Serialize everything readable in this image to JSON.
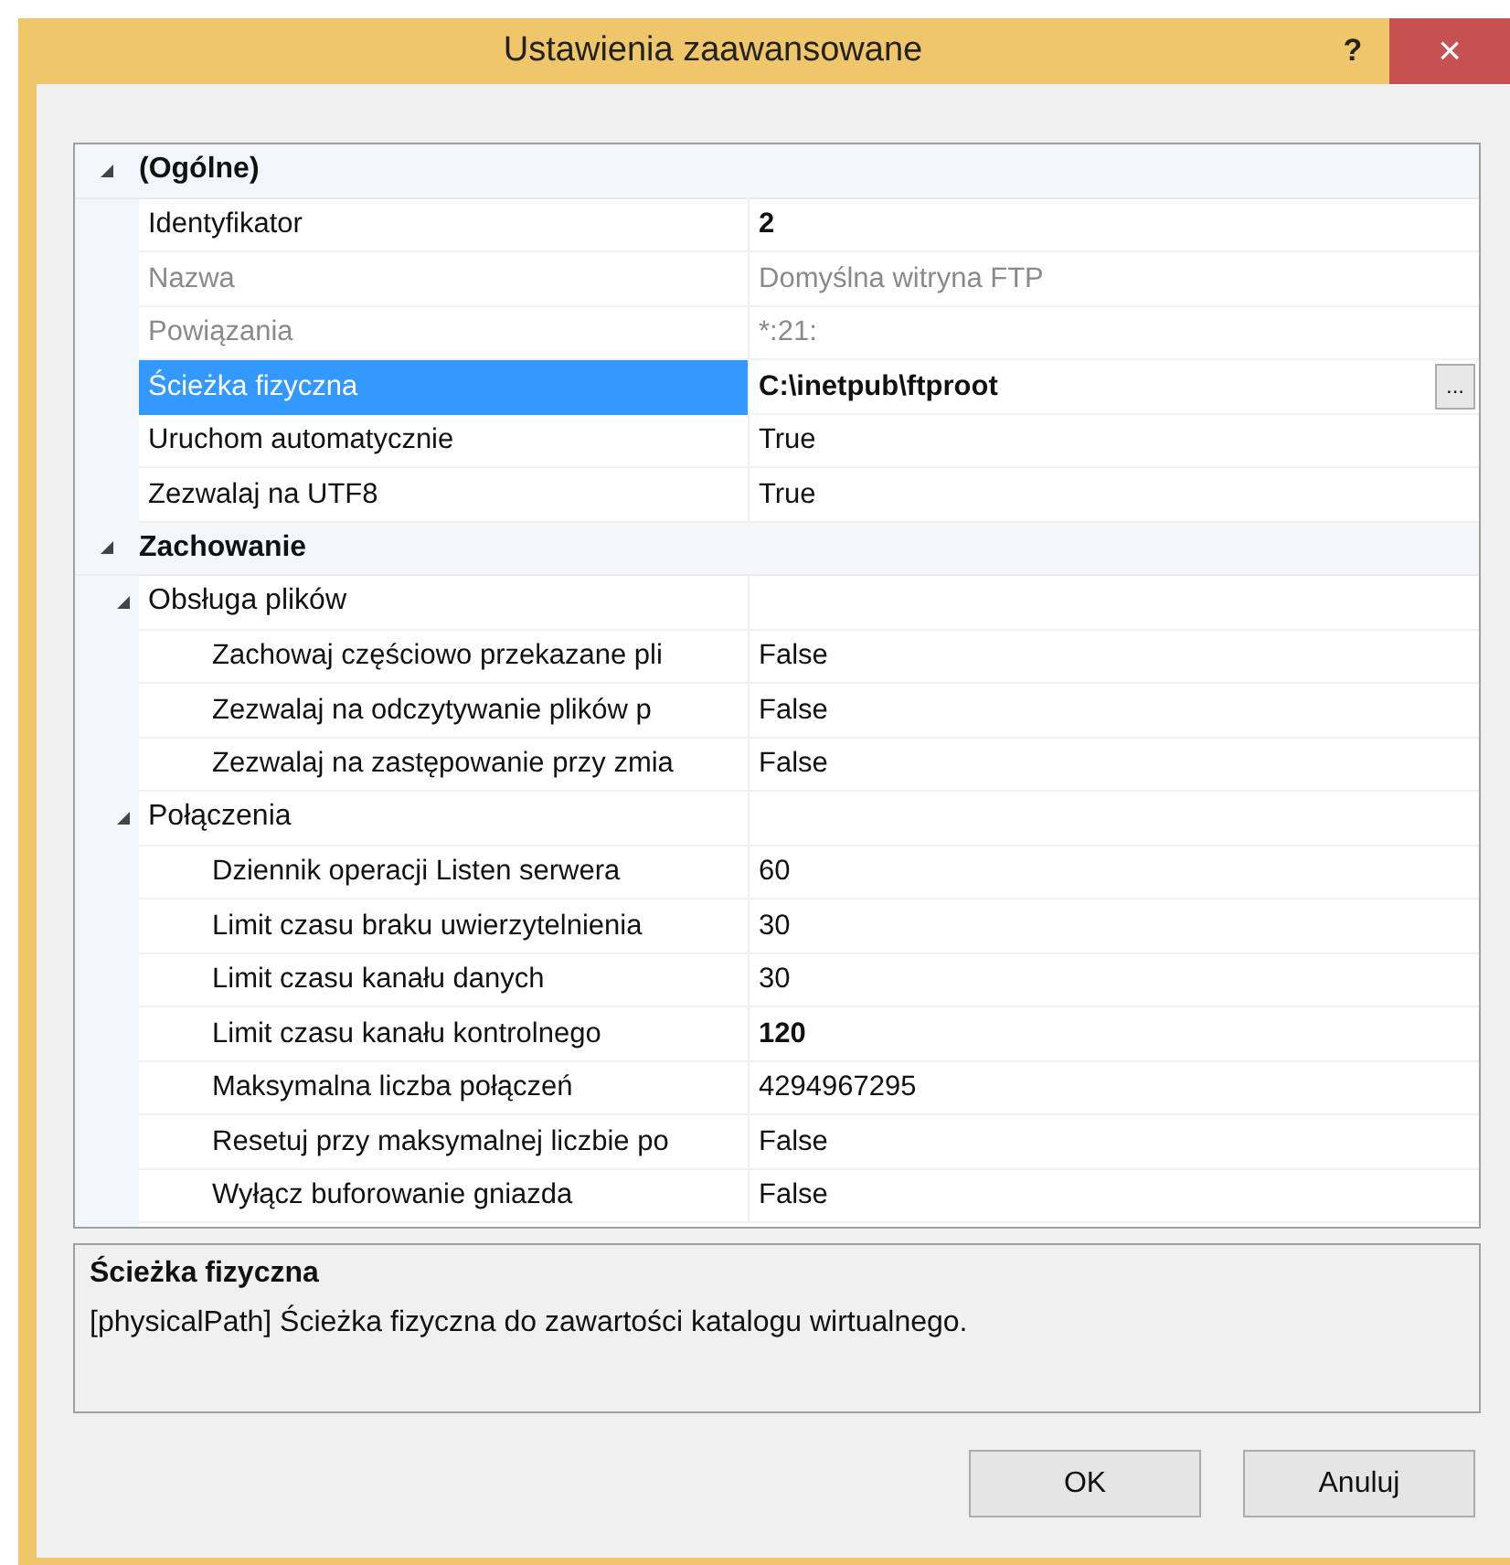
{
  "window": {
    "title": "Ustawienia zaawansowane",
    "help": "?",
    "close": "×"
  },
  "grid": [
    {
      "kind": "category",
      "label": "(Ogólne)",
      "expanded": true,
      "children": [
        {
          "kind": "property",
          "name": "Identyfikator",
          "value": "2",
          "modified": true,
          "disabled": false,
          "selected": false
        },
        {
          "kind": "property",
          "name": "Nazwa",
          "value": "Domyślna witryna FTP",
          "modified": false,
          "disabled": true,
          "selected": false
        },
        {
          "kind": "property",
          "name": "Powiązania",
          "value": "*:21:",
          "modified": false,
          "disabled": true,
          "selected": false
        },
        {
          "kind": "property",
          "name": "Ścieżka fizyczna",
          "value": "C:\\inetpub\\ftproot",
          "modified": true,
          "disabled": false,
          "selected": true,
          "button": "..."
        },
        {
          "kind": "property",
          "name": "Uruchom automatycznie",
          "value": "True",
          "modified": false,
          "disabled": false,
          "selected": false
        },
        {
          "kind": "property",
          "name": "Zezwalaj na UTF8",
          "value": "True",
          "modified": false,
          "disabled": false,
          "selected": false
        }
      ]
    },
    {
      "kind": "category",
      "label": "Zachowanie",
      "expanded": true,
      "children": [
        {
          "kind": "group",
          "label": "Obsługa plików",
          "expanded": true,
          "children": [
            {
              "kind": "property",
              "name": "Zachowaj częściowo przekazane pli",
              "value": "False",
              "modified": false,
              "disabled": false,
              "selected": false
            },
            {
              "kind": "property",
              "name": "Zezwalaj na odczytywanie plików p",
              "value": "False",
              "modified": false,
              "disabled": false,
              "selected": false
            },
            {
              "kind": "property",
              "name": "Zezwalaj na zastępowanie przy zmia",
              "value": "False",
              "modified": false,
              "disabled": false,
              "selected": false
            }
          ]
        },
        {
          "kind": "group",
          "label": "Połączenia",
          "expanded": true,
          "children": [
            {
              "kind": "property",
              "name": "Dziennik operacji Listen serwera",
              "value": "60",
              "modified": false,
              "disabled": false,
              "selected": false
            },
            {
              "kind": "property",
              "name": "Limit czasu braku uwierzytelnienia",
              "value": "30",
              "modified": false,
              "disabled": false,
              "selected": false
            },
            {
              "kind": "property",
              "name": "Limit czasu kanału danych",
              "value": "30",
              "modified": false,
              "disabled": false,
              "selected": false
            },
            {
              "kind": "property",
              "name": "Limit czasu kanału kontrolnego",
              "value": "120",
              "modified": true,
              "disabled": false,
              "selected": false
            },
            {
              "kind": "property",
              "name": "Maksymalna liczba połączeń",
              "value": "4294967295",
              "modified": false,
              "disabled": false,
              "selected": false
            },
            {
              "kind": "property",
              "name": "Resetuj przy maksymalnej liczbie po",
              "value": "False",
              "modified": false,
              "disabled": false,
              "selected": false
            },
            {
              "kind": "property",
              "name": "Wyłącz buforowanie gniazda",
              "value": "False",
              "modified": false,
              "disabled": false,
              "selected": false
            }
          ]
        }
      ]
    }
  ],
  "description": {
    "title": "Ścieżka fizyczna",
    "text": "[physicalPath] Ścieżka fizyczna do zawartości katalogu wirtualnego."
  },
  "buttons": [
    "OK",
    "Anuluj"
  ]
}
